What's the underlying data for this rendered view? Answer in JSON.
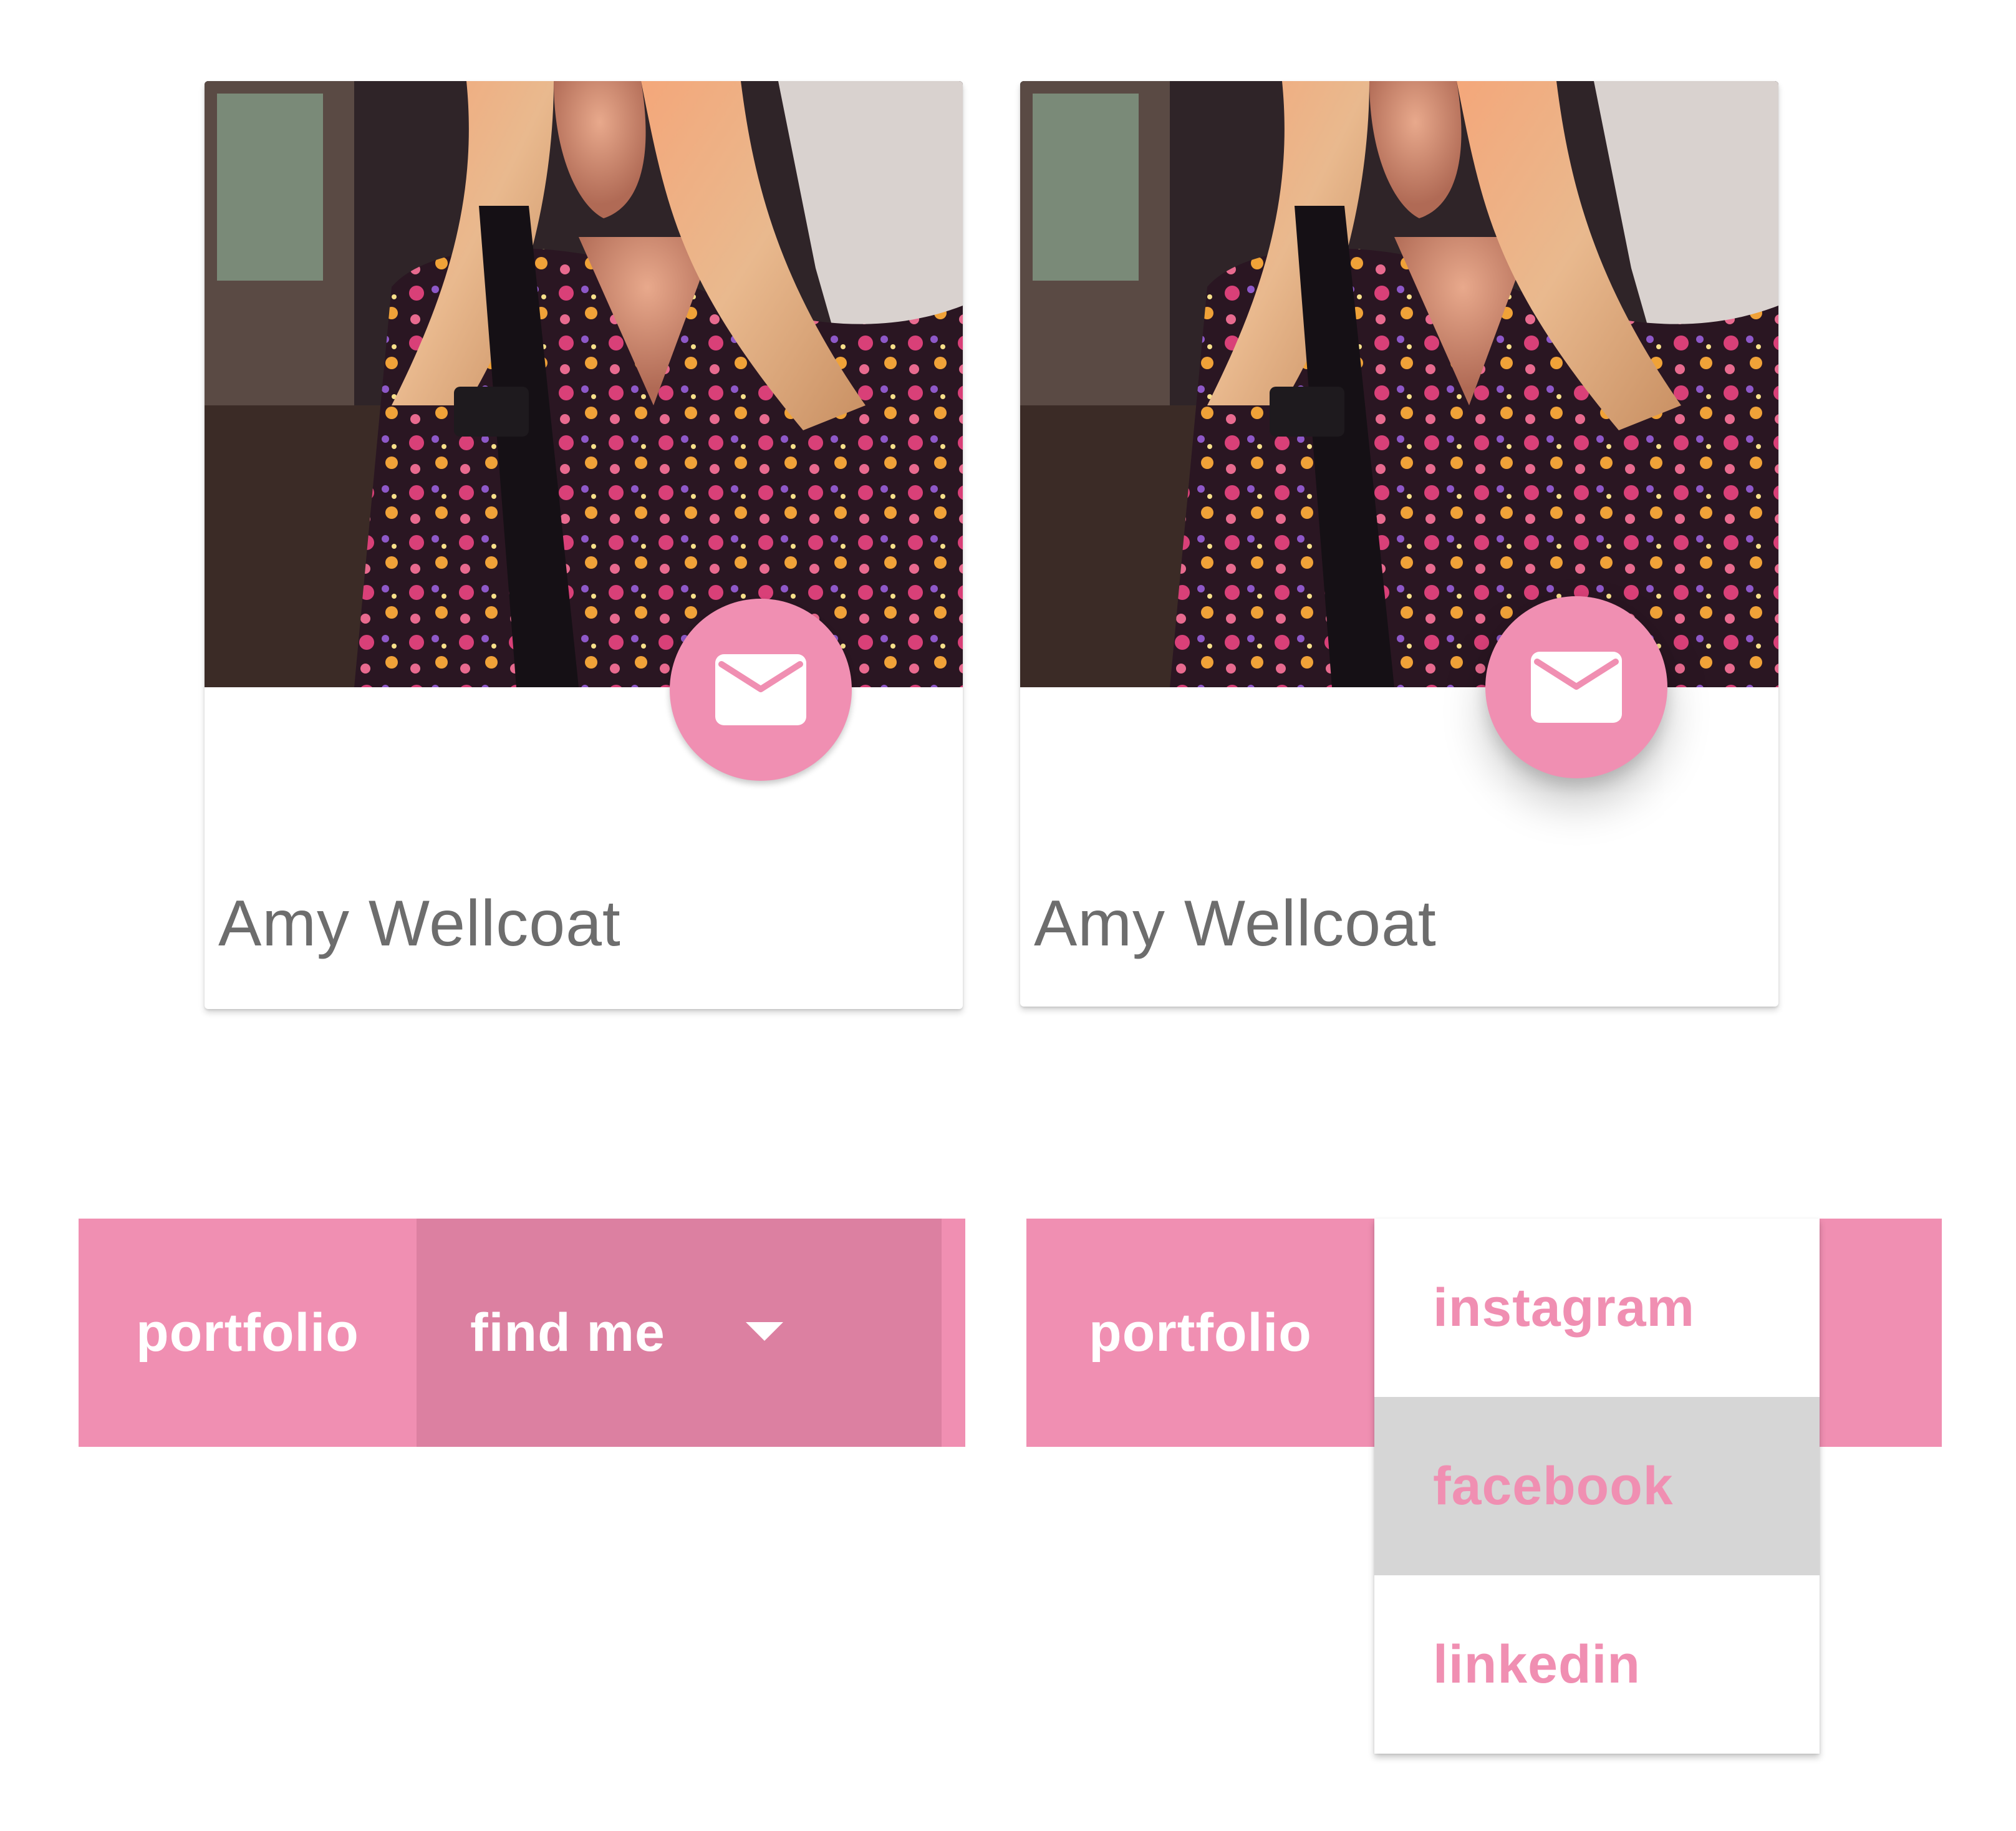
{
  "cards": [
    {
      "name": "Amy Wellcoat",
      "action_icon": "mail-icon"
    },
    {
      "name": "Amy Wellcoat",
      "action_icon": "mail-icon"
    }
  ],
  "navbar_closed": {
    "items": [
      {
        "label": "portfolio"
      },
      {
        "label": "find me",
        "icon": "caret-down-icon"
      }
    ]
  },
  "navbar_open": {
    "items": [
      {
        "label": "portfolio"
      }
    ],
    "dropdown": [
      {
        "label": "instagram",
        "state": "default"
      },
      {
        "label": "facebook",
        "state": "hover"
      },
      {
        "label": "linkedin",
        "state": "default"
      }
    ]
  },
  "colors": {
    "accent": "#f08fb2",
    "accent_active": "#dc80a1",
    "name_text": "#6d6d6d",
    "hover_bg": "#d6d6d6",
    "background": "#ffffff"
  }
}
